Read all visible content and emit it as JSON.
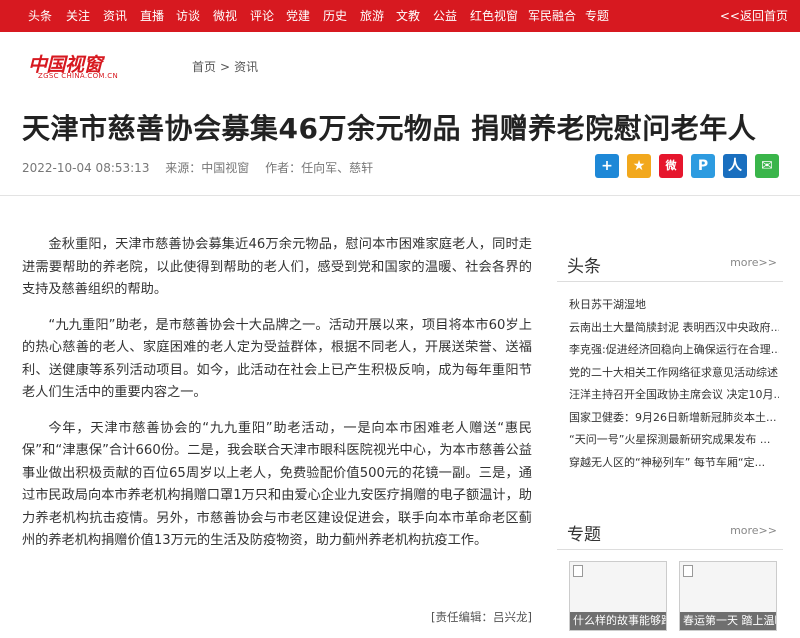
{
  "nav": {
    "items": [
      "头条",
      "关注",
      "资讯",
      "直播",
      "访谈",
      "微视",
      "评论",
      "党建",
      "历史",
      "旅游",
      "文教",
      "公益",
      "红色视窗",
      "军民融合",
      "专题"
    ],
    "back_label": "<<返回首页"
  },
  "logo": {
    "main": "中国视窗",
    "sub": "ZGSC CHINA.COM.CN"
  },
  "breadcrumb": {
    "home": "首页",
    "sep": ">",
    "section": "资讯"
  },
  "article": {
    "title": "天津市慈善协会募集46万余元物品 捐赠养老院慰问老年人",
    "datetime": "2022-10-04 08:53:13",
    "source": "来源：中国视窗",
    "author": "作者：任向军、慈轩",
    "paragraphs": [
      "金秋重阳，天津市慈善协会募集近46万余元物品，慰问本市困难家庭老人，同时走进需要帮助的养老院，以此使得到帮助的老人们，感受到党和国家的温暖、社会各界的支持及慈善组织的帮助。",
      "“九九重阳”助老，是市慈善协会十大品牌之一。活动开展以来，项目将本市60岁上的热心慈善的老人、家庭困难的老人定为受益群体，根据不同老人，开展送荣誉、送福利、送健康等系列活动项目。如今，此活动在社会上已产生积极反响，成为每年重阳节老人们生活中的重要内容之一。",
      "今年，天津市慈善协会的“九九重阳”助老活动，一是向本市困难老人赠送“惠民保”和“津惠保”合计660份。二是，我会联合天津市眼科医院视光中心，为本市慈善公益事业做出积极贡献的百位65周岁以上老人，免费验配价值500元的花镜一副。三是，通过市民政局向本市养老机构捐赠口罩1万只和由爱心企业九安医疗捐赠的电子额温计，助力养老机构抗击疫情。另外，市慈善协会与市老区建设促进会，联手向本市革命老区蓟州的养老机构捐赠价值13万元的生活及防疫物资，助力蓟州养老机构抗疫工作。"
    ],
    "editor": "[责任编辑：吕兴龙]"
  },
  "share": [
    {
      "icon": "plus-share-icon",
      "glyph": "+",
      "color": "#1e88d7"
    },
    {
      "icon": "qzone-icon",
      "glyph": "★",
      "color": "#f2a81d"
    },
    {
      "icon": "weibo-icon",
      "glyph": "微",
      "color": "#e6162d"
    },
    {
      "icon": "tencent-weibo-icon",
      "glyph": "P",
      "color": "#2d9be0"
    },
    {
      "icon": "renren-icon",
      "glyph": "人",
      "color": "#1a6fbf"
    },
    {
      "icon": "wechat-icon",
      "glyph": "✉",
      "color": "#3ab54a"
    }
  ],
  "sidebar": {
    "headlines_title": "头条",
    "more": "more>>",
    "headlines": [
      "秋日苏干湖湿地",
      "云南出土大量简牍封泥 表明西汉中央政府...",
      "李克强:促进经济回稳向上确保运行在合理...",
      "党的二十大相关工作网络征求意见活动综述",
      "汪洋主持召开全国政协主席会议 决定10月...",
      "国家卫健委：9月26日新增新冠肺炎本土...",
      "“天问一号”火星探测最新研究成果发布 ...",
      "穿越无人区的“神秘列车” 每节车厢“定..."
    ],
    "topics_title": "专题",
    "topics": [
      "什么样的故事能够跨...",
      "春运第一天 踏上温暖..."
    ]
  }
}
